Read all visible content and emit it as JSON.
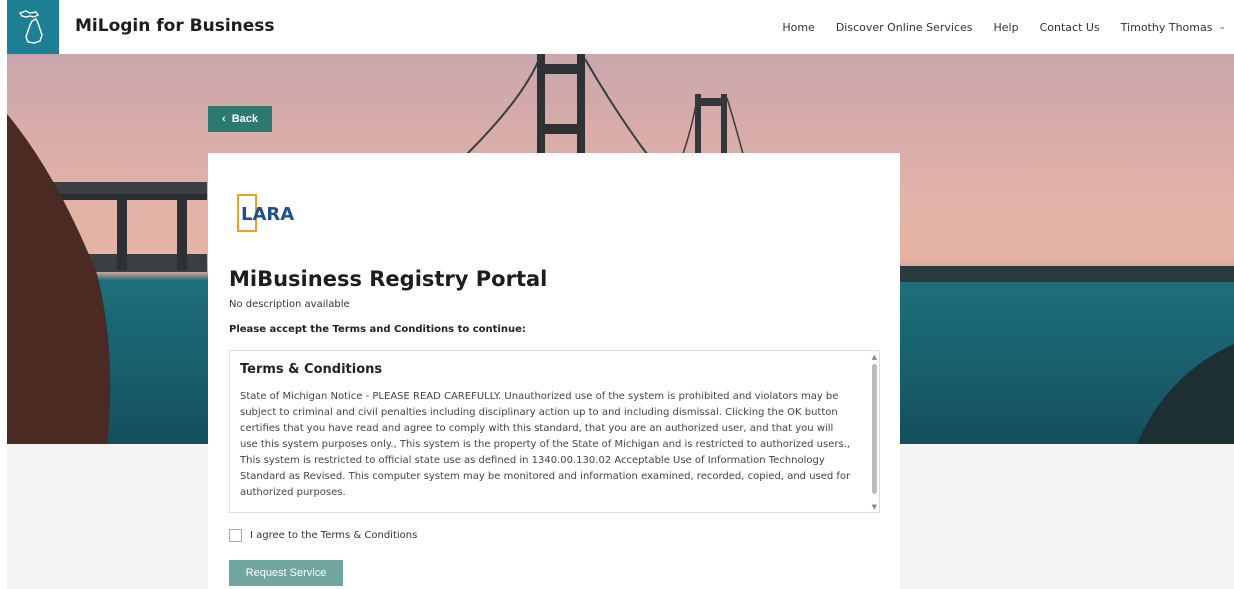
{
  "header": {
    "app_title": "MiLogin for Business",
    "nav": [
      "Home",
      "Discover Online Services",
      "Help",
      "Contact Us"
    ],
    "user_name": "Timothy Thomas"
  },
  "back_label": "Back",
  "card": {
    "logo_text": "LARA",
    "title": "MiBusiness Registry Portal",
    "description": "No description available",
    "accept_prompt": "Please accept the Terms and Conditions to continue:",
    "terms": {
      "heading": "Terms & Conditions",
      "body": "State of Michigan Notice - PLEASE READ CAREFULLY. Unauthorized use of the system is prohibited and violators may be subject to criminal and civil penalties including disciplinary action up to and including dismissal. Clicking the OK button certifies that you have read and agree to comply with this standard, that you are an authorized user, and that you will use this system purposes only., This system is the property of the State of Michigan and is restricted to authorized users., This system is restricted to official state use as defined in 1340.00.130.02 Acceptable Use of Information Technology Standard as Revised. This computer system may be monitored and information examined, recorded, copied, and used for authorized purposes."
    },
    "agree_label": "I agree to the Terms & Conditions",
    "agree_checked": false,
    "request_label": "Request Service"
  },
  "colors": {
    "brand_teal": "#1c7f93",
    "back_button": "#2c7a6e",
    "request_button_disabled": "#6fa6a0"
  }
}
